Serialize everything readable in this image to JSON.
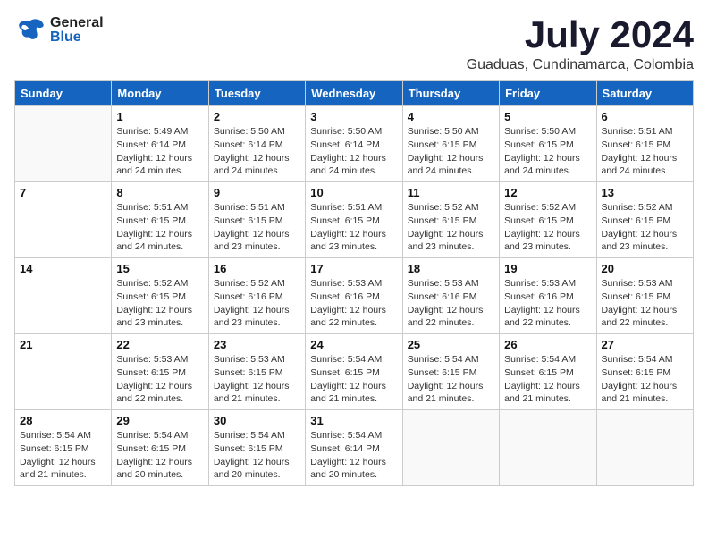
{
  "header": {
    "logo_general": "General",
    "logo_blue": "Blue",
    "month_title": "July 2024",
    "location": "Guaduas, Cundinamarca, Colombia"
  },
  "calendar": {
    "weekdays": [
      "Sunday",
      "Monday",
      "Tuesday",
      "Wednesday",
      "Thursday",
      "Friday",
      "Saturday"
    ],
    "weeks": [
      [
        {
          "day": "",
          "info": ""
        },
        {
          "day": "1",
          "info": "Sunrise: 5:49 AM\nSunset: 6:14 PM\nDaylight: 12 hours\nand 24 minutes."
        },
        {
          "day": "2",
          "info": "Sunrise: 5:50 AM\nSunset: 6:14 PM\nDaylight: 12 hours\nand 24 minutes."
        },
        {
          "day": "3",
          "info": "Sunrise: 5:50 AM\nSunset: 6:14 PM\nDaylight: 12 hours\nand 24 minutes."
        },
        {
          "day": "4",
          "info": "Sunrise: 5:50 AM\nSunset: 6:15 PM\nDaylight: 12 hours\nand 24 minutes."
        },
        {
          "day": "5",
          "info": "Sunrise: 5:50 AM\nSunset: 6:15 PM\nDaylight: 12 hours\nand 24 minutes."
        },
        {
          "day": "6",
          "info": "Sunrise: 5:51 AM\nSunset: 6:15 PM\nDaylight: 12 hours\nand 24 minutes."
        }
      ],
      [
        {
          "day": "7",
          "info": ""
        },
        {
          "day": "8",
          "info": "Sunrise: 5:51 AM\nSunset: 6:15 PM\nDaylight: 12 hours\nand 24 minutes."
        },
        {
          "day": "9",
          "info": "Sunrise: 5:51 AM\nSunset: 6:15 PM\nDaylight: 12 hours\nand 23 minutes."
        },
        {
          "day": "10",
          "info": "Sunrise: 5:51 AM\nSunset: 6:15 PM\nDaylight: 12 hours\nand 23 minutes."
        },
        {
          "day": "11",
          "info": "Sunrise: 5:52 AM\nSunset: 6:15 PM\nDaylight: 12 hours\nand 23 minutes."
        },
        {
          "day": "12",
          "info": "Sunrise: 5:52 AM\nSunset: 6:15 PM\nDaylight: 12 hours\nand 23 minutes."
        },
        {
          "day": "13",
          "info": "Sunrise: 5:52 AM\nSunset: 6:15 PM\nDaylight: 12 hours\nand 23 minutes."
        }
      ],
      [
        {
          "day": "14",
          "info": ""
        },
        {
          "day": "15",
          "info": "Sunrise: 5:52 AM\nSunset: 6:15 PM\nDaylight: 12 hours\nand 23 minutes."
        },
        {
          "day": "16",
          "info": "Sunrise: 5:52 AM\nSunset: 6:16 PM\nDaylight: 12 hours\nand 23 minutes."
        },
        {
          "day": "17",
          "info": "Sunrise: 5:53 AM\nSunset: 6:16 PM\nDaylight: 12 hours\nand 22 minutes."
        },
        {
          "day": "18",
          "info": "Sunrise: 5:53 AM\nSunset: 6:16 PM\nDaylight: 12 hours\nand 22 minutes."
        },
        {
          "day": "19",
          "info": "Sunrise: 5:53 AM\nSunset: 6:16 PM\nDaylight: 12 hours\nand 22 minutes."
        },
        {
          "day": "20",
          "info": "Sunrise: 5:53 AM\nSunset: 6:15 PM\nDaylight: 12 hours\nand 22 minutes."
        }
      ],
      [
        {
          "day": "21",
          "info": ""
        },
        {
          "day": "22",
          "info": "Sunrise: 5:53 AM\nSunset: 6:15 PM\nDaylight: 12 hours\nand 22 minutes."
        },
        {
          "day": "23",
          "info": "Sunrise: 5:53 AM\nSunset: 6:15 PM\nDaylight: 12 hours\nand 21 minutes."
        },
        {
          "day": "24",
          "info": "Sunrise: 5:54 AM\nSunset: 6:15 PM\nDaylight: 12 hours\nand 21 minutes."
        },
        {
          "day": "25",
          "info": "Sunrise: 5:54 AM\nSunset: 6:15 PM\nDaylight: 12 hours\nand 21 minutes."
        },
        {
          "day": "26",
          "info": "Sunrise: 5:54 AM\nSunset: 6:15 PM\nDaylight: 12 hours\nand 21 minutes."
        },
        {
          "day": "27",
          "info": "Sunrise: 5:54 AM\nSunset: 6:15 PM\nDaylight: 12 hours\nand 21 minutes."
        }
      ],
      [
        {
          "day": "28",
          "info": "Sunrise: 5:54 AM\nSunset: 6:15 PM\nDaylight: 12 hours\nand 21 minutes."
        },
        {
          "day": "29",
          "info": "Sunrise: 5:54 AM\nSunset: 6:15 PM\nDaylight: 12 hours\nand 20 minutes."
        },
        {
          "day": "30",
          "info": "Sunrise: 5:54 AM\nSunset: 6:15 PM\nDaylight: 12 hours\nand 20 minutes."
        },
        {
          "day": "31",
          "info": "Sunrise: 5:54 AM\nSunset: 6:14 PM\nDaylight: 12 hours\nand 20 minutes."
        },
        {
          "day": "",
          "info": ""
        },
        {
          "day": "",
          "info": ""
        },
        {
          "day": "",
          "info": ""
        }
      ]
    ]
  }
}
